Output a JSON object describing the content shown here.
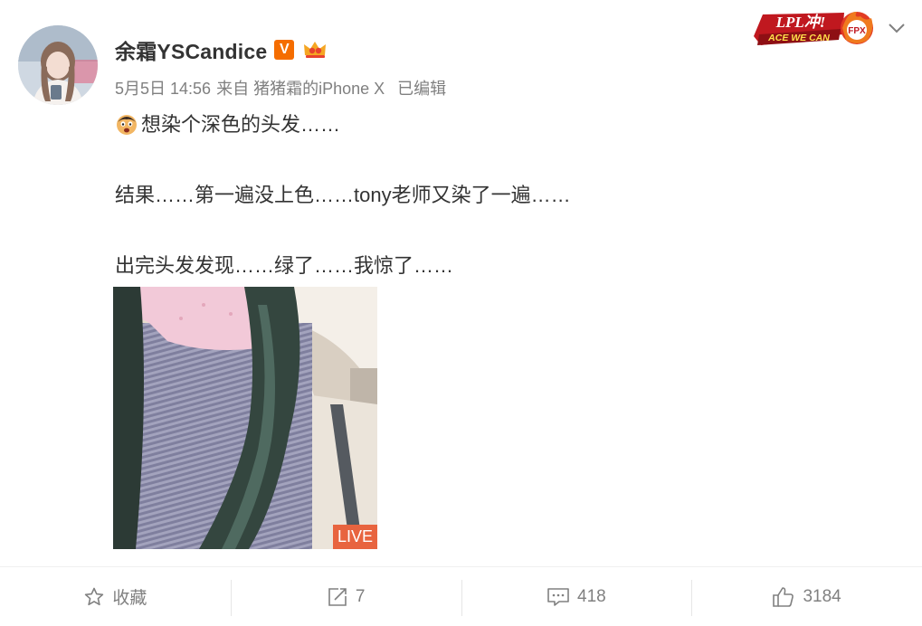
{
  "author": {
    "name": "余霜YSCandice",
    "verified_badge": "V",
    "verified_color": "#f56d00",
    "fan_badge_icon": "fan-crown-icon"
  },
  "meta": {
    "date_time": "5月5日 14:56",
    "source": "来自 猪猪霜的iPhone X",
    "edited": "已编辑"
  },
  "post": {
    "line1": "想染个深色的头发……",
    "line2": "结果……第一遍没上色……tony老师又染了一遍……",
    "line3": "出完头发发现……绿了……我惊了……",
    "emoji_icon": "shocked-face-emoji-icon"
  },
  "image": {
    "live_label": "LIVE",
    "live_color": "#e8643f"
  },
  "promo": {
    "line1": "LPL冲!",
    "line2": "ACE WE CAN",
    "team": "FPX",
    "accent": "#c0181f"
  },
  "actions": {
    "favorite": "收藏",
    "repost_count": "7",
    "comment_count": "418",
    "like_count": "3184"
  }
}
